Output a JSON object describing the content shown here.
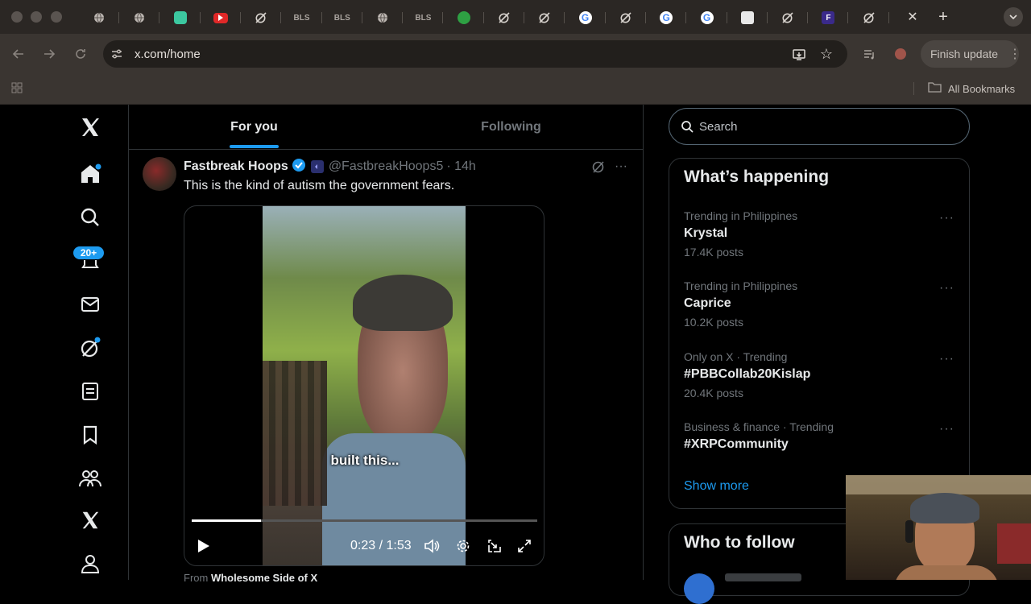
{
  "browser": {
    "url": "x.com/home",
    "finish_update_label": "Finish update",
    "all_bookmarks_label": "All Bookmarks",
    "tabs": [
      {
        "icon": "globe-icon",
        "label": ""
      },
      {
        "icon": "globe-icon",
        "label": ""
      },
      {
        "icon": "robot-icon",
        "label": ""
      },
      {
        "icon": "youtube-icon",
        "label": ""
      },
      {
        "icon": "no-sign-icon",
        "label": ""
      },
      {
        "icon": "bls-icon",
        "label": "BLS"
      },
      {
        "icon": "bls-icon",
        "label": "BLS"
      },
      {
        "icon": "globe-icon",
        "label": ""
      },
      {
        "icon": "bls-icon",
        "label": "BLS"
      },
      {
        "icon": "mic-icon",
        "label": ""
      },
      {
        "icon": "no-sign-icon",
        "label": ""
      },
      {
        "icon": "no-sign-icon",
        "label": ""
      },
      {
        "icon": "google-icon",
        "label": "G"
      },
      {
        "icon": "no-sign-icon",
        "label": ""
      },
      {
        "icon": "google-icon",
        "label": "G"
      },
      {
        "icon": "google-icon",
        "label": "G"
      },
      {
        "icon": "hexagon-icon",
        "label": ""
      },
      {
        "icon": "no-sign-icon",
        "label": ""
      },
      {
        "icon": "f-icon",
        "label": "F"
      },
      {
        "icon": "no-sign-icon",
        "label": ""
      }
    ]
  },
  "nav": {
    "notifications_badge": "20+"
  },
  "feed": {
    "tab_for_you": "For you",
    "tab_following": "Following",
    "post": {
      "author": "Fastbreak Hoops",
      "handle": "@FastbreakHoops5",
      "time": "· 14h",
      "text": "This is the kind of autism the government fears.",
      "caption": "built this...",
      "video_time": "0:23 / 1:53",
      "video_progress": 0.2,
      "from_prefix": "From",
      "from_source": "Wholesome Side of X"
    }
  },
  "sidebar": {
    "search_placeholder": "Search",
    "whats_happening_title": "What’s happening",
    "trends": [
      {
        "meta": "Trending in Philippines",
        "title": "Krystal",
        "count": "17.4K posts"
      },
      {
        "meta": "Trending in Philippines",
        "title": "Caprice",
        "count": "10.2K posts"
      },
      {
        "meta": "Only on X · Trending",
        "title": "#PBBCollab20Kislap",
        "count": "20.4K posts"
      },
      {
        "meta": "Business & finance · Trending",
        "title": "#XRPCommunity",
        "count": ""
      }
    ],
    "show_more": "Show more",
    "who_to_follow_title": "Who to follow"
  },
  "colors": {
    "accent": "#1d9bf0",
    "background": "#000000",
    "border": "#2f3336",
    "muted": "#71767b"
  }
}
